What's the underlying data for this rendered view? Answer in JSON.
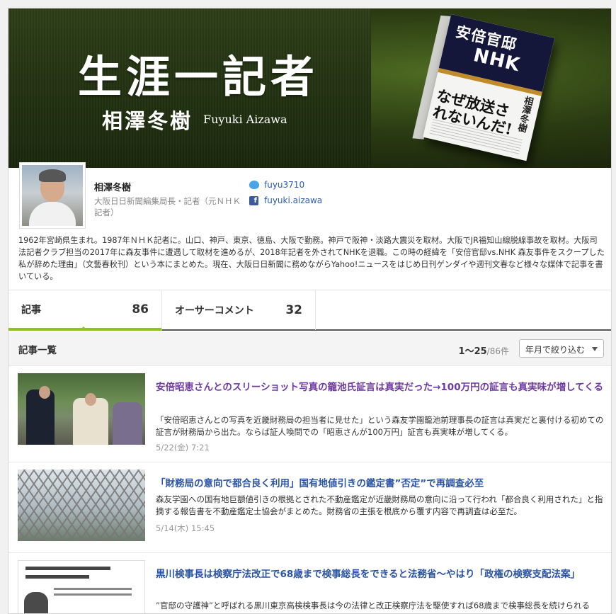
{
  "banner": {
    "title": "生涯一記者",
    "name_jp": "相澤冬樹",
    "name_en": "Fuyuki Aizawa",
    "book": {
      "title_line1": "安倍官邸",
      "title_line2": "NHK",
      "author": "相澤冬樹",
      "catch": "なぜ放送されないんだ!"
    }
  },
  "profile": {
    "name": "相澤冬樹",
    "title": "大阪日日新聞編集局長・記者（元ＮＨＫ記者）",
    "twitter": "fuyu3710",
    "facebook": "fuyuki.aizawa",
    "bio": "1962年宮崎県生まれ。1987年ＮＨＫ記者に。山口、神戸、東京、徳島、大阪で勤務。神戸で阪神・淡路大震災を取材。大阪でJR福知山線脱線事故を取材。大阪司法記者クラブ担当の2017年に森友事件に遭遇して取材を進めるが、2018年記者を外されてNHKを退職。この時の経緯を「安倍官邸vs.NHK 森友事件をスクープした私が辞めた理由」（文藝春秋刊）という本にまとめた。現在、大阪日日新聞に務めながらYahoo!ニュースをはじめ日刊ゲンダイや週刊文春など様々な媒体で記事を書いている。"
  },
  "tabs": [
    {
      "label": "記事",
      "count": "86"
    },
    {
      "label": "オーサーコメント",
      "count": "32"
    }
  ],
  "list": {
    "title": "記事一覧",
    "range": "1〜25",
    "total": "/86件",
    "filter": "年月で絞り込む"
  },
  "articles": [
    {
      "title": "安倍昭恵さんとのスリーショット写真の籠池氏証言は真実だった→100万円の証言も真実味が増してくる",
      "desc": "「安倍昭恵さんとの写真を近畿財務局の担当者に見せた」という森友学園籠池前理事長の証言は真実だと裏付ける初めての証言が財務局から出た。ならば証人喚問での「昭恵さんが100万円」証言も真実味が増してくる。",
      "date": "5/22(金) 7:21"
    },
    {
      "title": "「財務局の意向で都合良く利用」国有地値引きの鑑定書”否定”で再調査必至",
      "desc": "森友学園への国有地巨額値引きの根拠とされた不動産鑑定が近畿財務局の意向に沿って行われ「都合良く利用された」と指摘する報告書を不動産鑑定士協会がまとめた。財務省の主張を根底から覆す内容で再調査は必至だ。",
      "date": "5/14(木) 15:45"
    },
    {
      "title": "黒川検事長は検察庁法改正で68歳まで検事総長をできると法務省〜やはり「政権の検察支配法案」",
      "desc": "”官邸の守護神”と呼ばれる黒川東京高検検事長は今の法律と改正検察庁法を駆使すれば68歳まで検事総長を続けられると、法務省が認めた。検察庁法改正案は「政権の検察支配法案」であることが一段と明確になった。",
      "date": ""
    }
  ]
}
